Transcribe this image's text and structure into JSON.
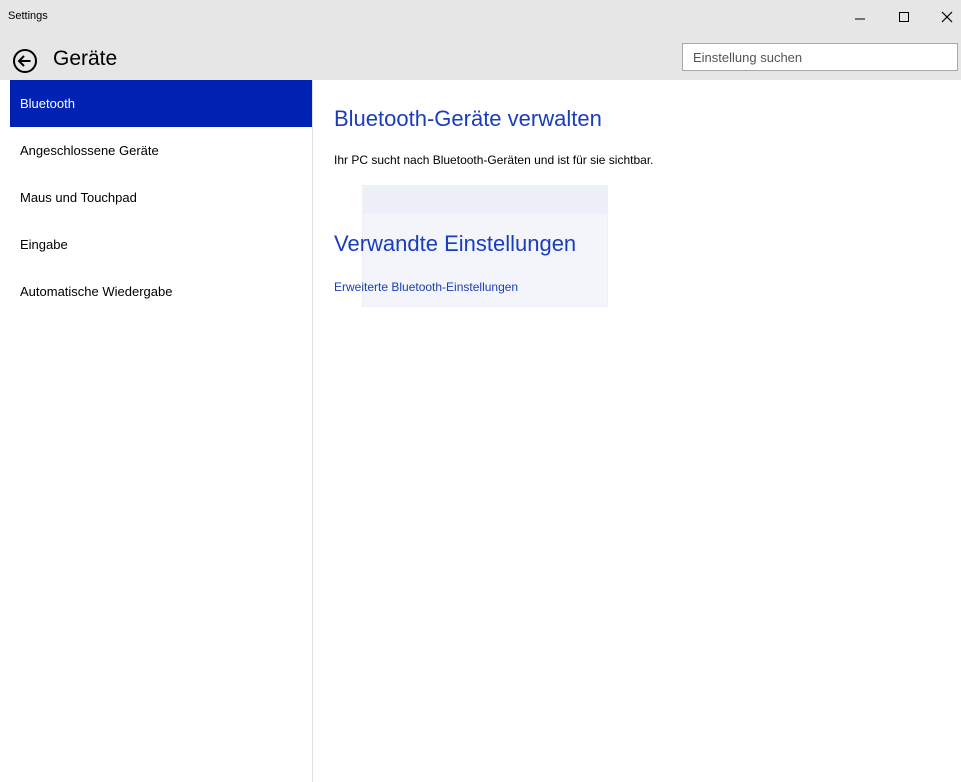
{
  "window": {
    "title": "Settings"
  },
  "header": {
    "page_title": "Geräte",
    "search_placeholder": "Einstellung suchen"
  },
  "sidebar": {
    "items": [
      {
        "label": "Bluetooth",
        "active": true
      },
      {
        "label": "Angeschlossene Geräte",
        "active": false
      },
      {
        "label": "Maus und Touchpad",
        "active": false
      },
      {
        "label": "Eingabe",
        "active": false
      },
      {
        "label": "Automatische Wiedergabe",
        "active": false
      }
    ]
  },
  "main": {
    "heading": "Bluetooth-Geräte verwalten",
    "description": "Ihr PC sucht nach Bluetooth-Geräten und ist für sie sichtbar.",
    "related_heading": "Verwandte Einstellungen",
    "related_link": "Erweiterte Bluetooth-Einstellungen"
  },
  "colors": {
    "accent": "#0022b3",
    "heading_blue": "#1a3dbb",
    "chrome_gray": "#e6e6e6"
  },
  "icons": {
    "back": "arrow-left-circle-icon",
    "minimize": "minimize-icon",
    "maximize": "maximize-icon",
    "close": "close-icon"
  }
}
